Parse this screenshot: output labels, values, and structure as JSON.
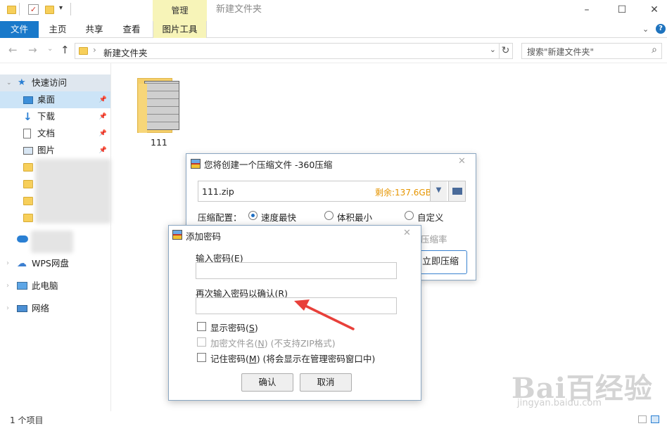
{
  "titlebar": {
    "manage_tab": "管理",
    "window_title": "新建文件夹",
    "min": "–",
    "max": "☐",
    "close": "✕"
  },
  "ribbon": {
    "tabs": [
      "文件",
      "主页",
      "共享",
      "查看",
      "图片工具"
    ],
    "help": "?"
  },
  "address": {
    "path": "新建文件夹",
    "search_placeholder": "搜索\"新建文件夹\""
  },
  "sidebar": {
    "quick_access": "快速访问",
    "items": [
      "桌面",
      "下载",
      "文档",
      "图片"
    ],
    "wps": "WPS网盘",
    "pc": "此电脑",
    "network": "网络"
  },
  "content": {
    "file_name": "111"
  },
  "status": {
    "count": "1 个项目"
  },
  "compress_dialog": {
    "title": "您将创建一个压缩文件 -360压缩",
    "filename": "111.zip",
    "remaining": "剩余:137.6GB",
    "config_label": "压缩配置：",
    "options": [
      "速度最快",
      "体积最小",
      "自定义"
    ],
    "ratio_partial": "压缩率",
    "compress_button": "立即压缩"
  },
  "password_dialog": {
    "title": "添加密码",
    "enter_label": "输入密码(",
    "enter_key": "E",
    "confirm_label": "再次输入密码以确认(",
    "confirm_key": "R",
    "show_label": "显示密码(",
    "show_key": "S",
    "encrypt_label": "加密文件名(",
    "encrypt_key": "N",
    "encrypt_note": ") (不支持ZIP格式)",
    "remember_label": "记住密码(",
    "remember_key": "M",
    "remember_note": ") (将会显示在管理密码窗口中)",
    "close_paren": ")",
    "ok": "确认",
    "cancel": "取消"
  },
  "watermark": {
    "text": "Bai百经验",
    "url": "jingyan.baidu.com"
  },
  "colors": {
    "accent": "#1979ca",
    "picture_tools": "#f7f4b8",
    "remaining": "#e69500",
    "arrow": "#e8403a"
  }
}
